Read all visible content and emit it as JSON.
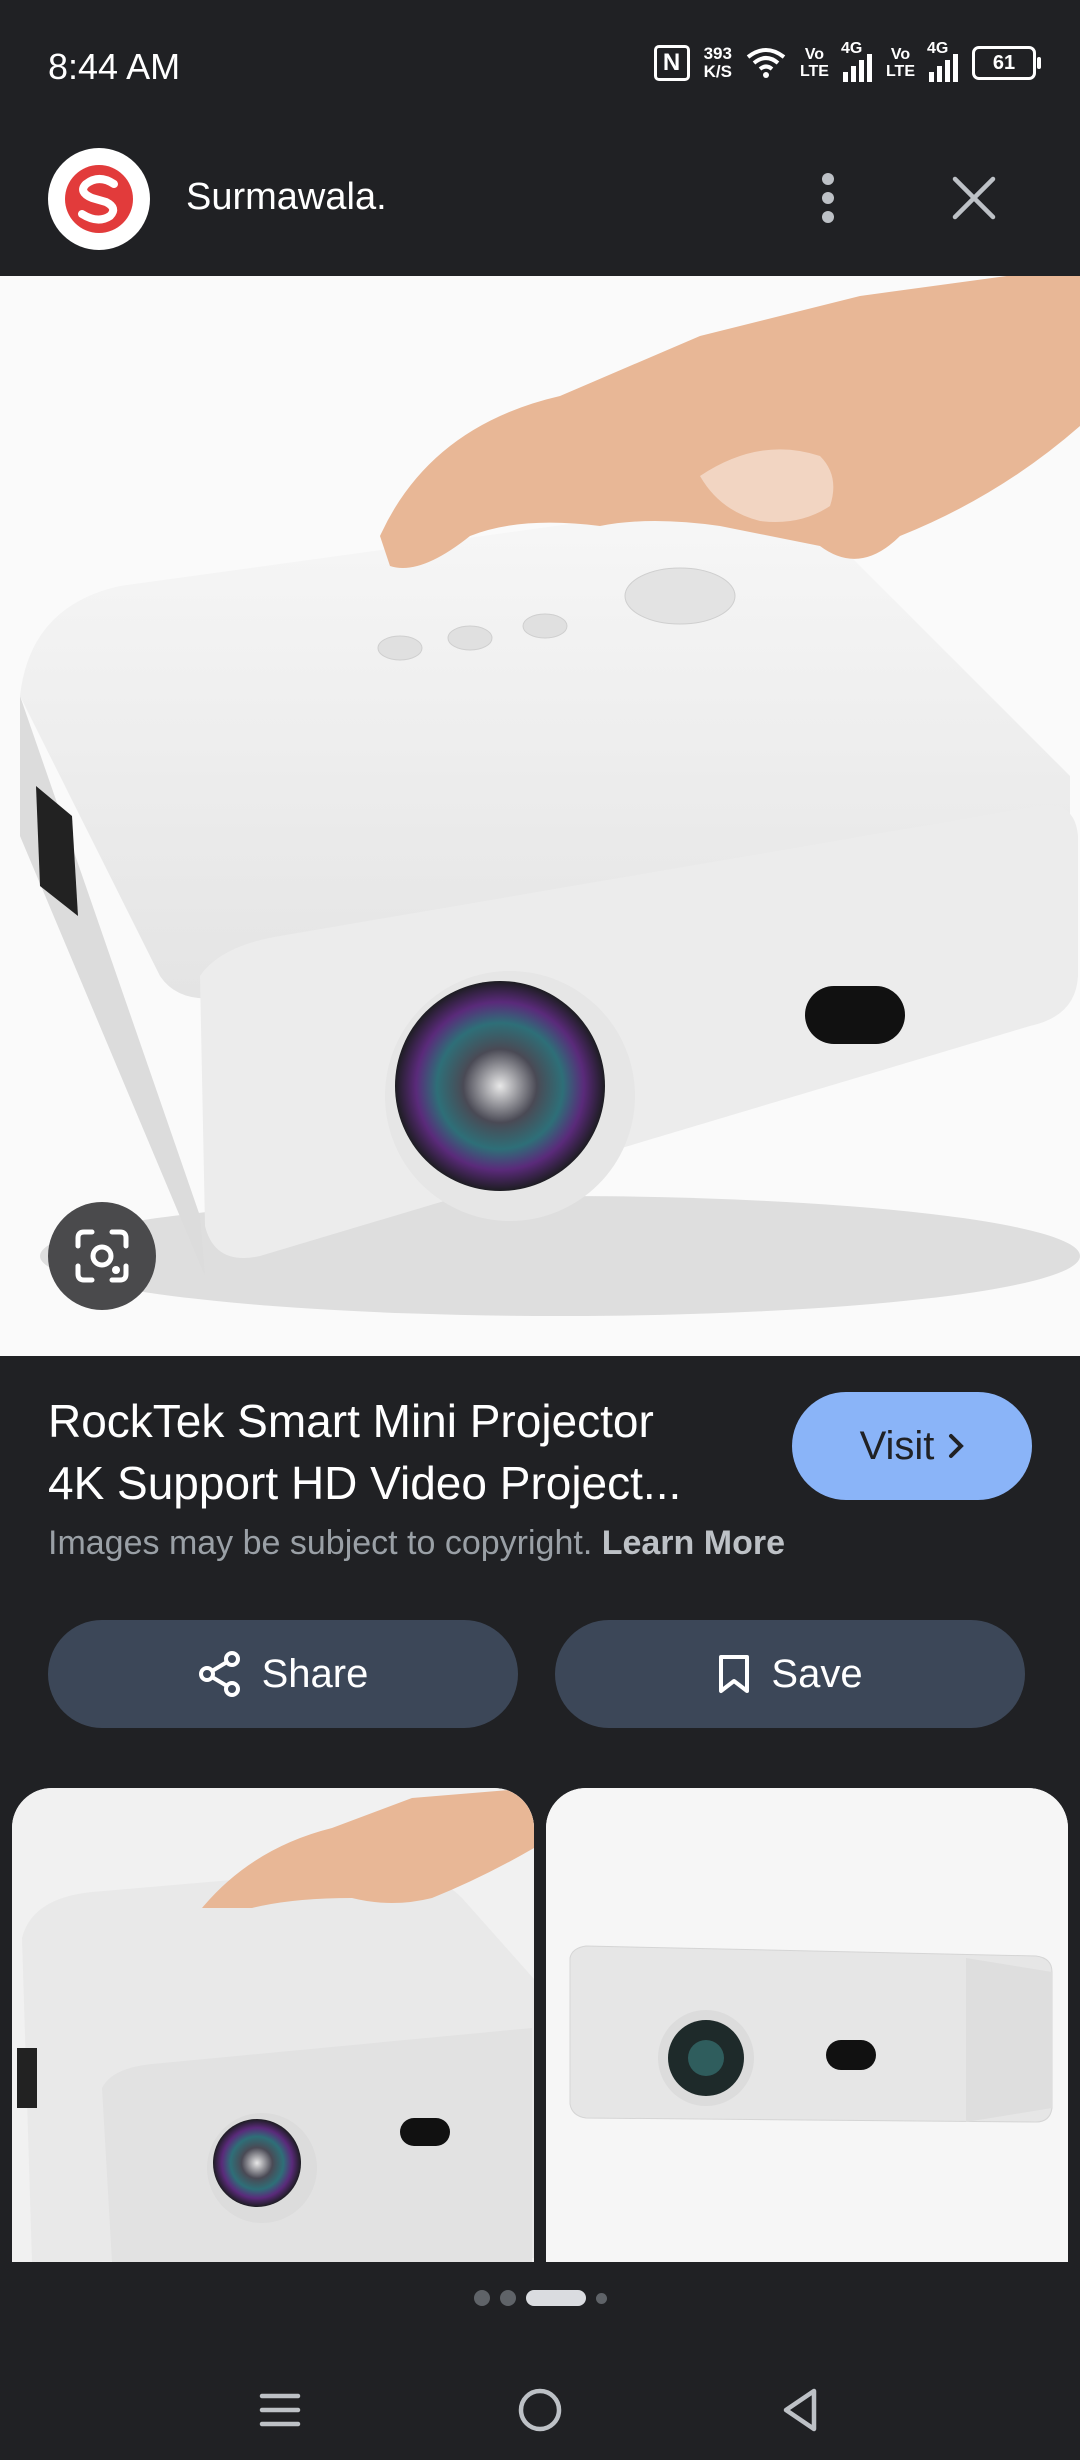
{
  "status_bar": {
    "time": "8:44 AM",
    "net_speed_value": "393",
    "net_speed_unit": "K/S",
    "volte1": "Vo\nLTE",
    "sim1_label": "4G",
    "volte2": "Vo\nLTE",
    "sim2_label": "4G",
    "battery": "61"
  },
  "header": {
    "site_name": "Surmawala."
  },
  "product": {
    "title_line1": "RockTek Smart Mini Projector",
    "title_line2": "4K Support HD Video Project...",
    "visit_label": "Visit",
    "copyright_text": "Images may be subject to copyright.",
    "learn_more": "Learn More"
  },
  "actions": {
    "share_label": "Share",
    "save_label": "Save"
  },
  "pagination": {
    "total": 4,
    "active_index": 2
  },
  "colors": {
    "background": "#202124",
    "visit_button": "#8ab4f8",
    "action_button": "#3c4758"
  }
}
